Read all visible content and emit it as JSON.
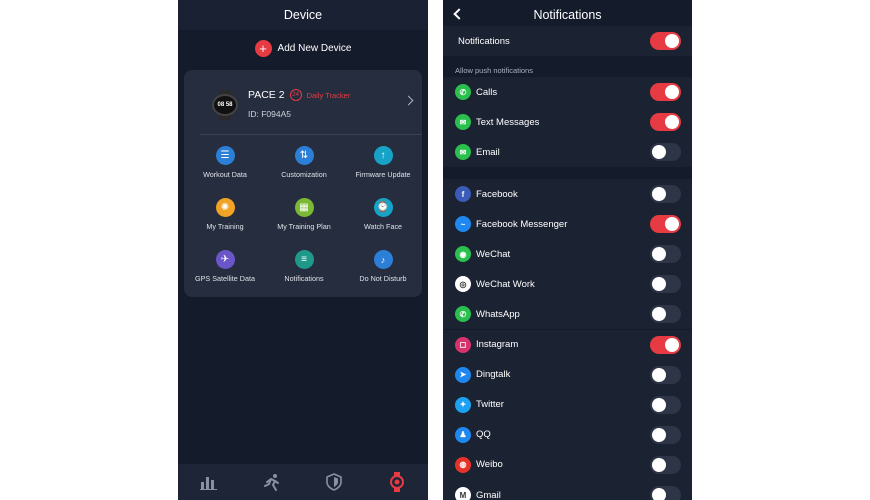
{
  "left": {
    "title": "Device",
    "add_device": "Add New Device",
    "device": {
      "name": "PACE 2",
      "badge": "24",
      "badge_text": "Daily Tracker",
      "id": "ID: F094A5",
      "watch_face_text": "08 58"
    },
    "features": [
      {
        "label": "Workout Data",
        "icon": "list-icon",
        "color": "#2c7fd6"
      },
      {
        "label": "Customization",
        "icon": "sliders-icon",
        "color": "#2c7fd6"
      },
      {
        "label": "Firmware Update",
        "icon": "arrow-up-icon",
        "color": "#17a3c7"
      },
      {
        "label": "My Training",
        "icon": "sparkle-icon",
        "color": "#f0a324"
      },
      {
        "label": "My Training Plan",
        "icon": "calendar-icon",
        "color": "#7bb935"
      },
      {
        "label": "Watch Face",
        "icon": "watch-icon",
        "color": "#17a3c7"
      },
      {
        "label": "GPS Satellite Data",
        "icon": "satellite-icon",
        "color": "#6a56c9"
      },
      {
        "label": "Notifications",
        "icon": "message-icon",
        "color": "#1f9a8a"
      },
      {
        "label": "Do Not Disturb",
        "icon": "bell-icon",
        "color": "#2c7fd6"
      }
    ],
    "tabs": [
      "stats-tab-icon",
      "running-tab-icon",
      "shield-tab-icon",
      "watch-tab-icon"
    ],
    "accent": "#e63b43"
  },
  "right": {
    "title": "Notifications",
    "master_label": "Notifications",
    "master_on": true,
    "section_label": "Allow push notifications",
    "group1": [
      {
        "label": "Calls",
        "on": true,
        "color": "#2bbf4e",
        "glyph": "✆"
      },
      {
        "label": "Text Messages",
        "on": true,
        "color": "#2bbf4e",
        "glyph": "✉"
      },
      {
        "label": "Email",
        "on": false,
        "color": "#2bbf4e",
        "glyph": "✉"
      }
    ],
    "group2": [
      {
        "label": "Facebook",
        "on": false,
        "color": "#3b5bb8",
        "glyph": "f"
      },
      {
        "label": "Facebook Messenger",
        "on": true,
        "color": "#1e88f0",
        "glyph": "~"
      },
      {
        "label": "WeChat",
        "on": false,
        "color": "#2bbf4e",
        "glyph": "◉"
      },
      {
        "label": "WeChat Work",
        "on": false,
        "color": "#ffffff",
        "glyph": "◎"
      },
      {
        "label": "WhatsApp",
        "on": false,
        "color": "#2bbf4e",
        "glyph": "✆"
      },
      {
        "label": "Instagram",
        "on": true,
        "color": "#d6336c",
        "glyph": "◻"
      },
      {
        "label": "Dingtalk",
        "on": false,
        "color": "#1e88f0",
        "glyph": "➤"
      },
      {
        "label": "Twitter",
        "on": false,
        "color": "#1da1f2",
        "glyph": "✦"
      },
      {
        "label": "QQ",
        "on": false,
        "color": "#1e88f0",
        "glyph": "♟"
      },
      {
        "label": "Weibo",
        "on": false,
        "color": "#e6332a",
        "glyph": "◍"
      },
      {
        "label": "Gmail",
        "on": false,
        "color": "#ffffff",
        "glyph": "M"
      }
    ]
  }
}
